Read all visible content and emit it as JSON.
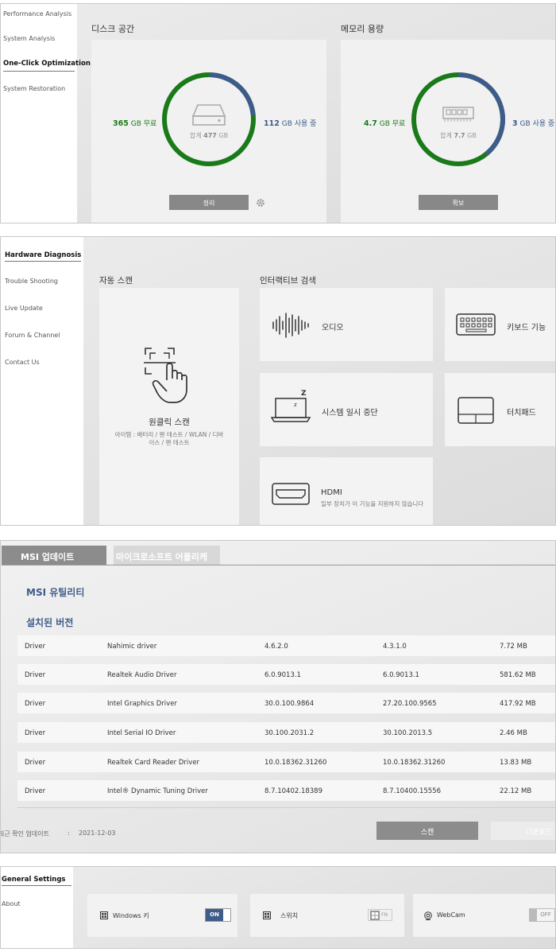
{
  "panel1": {
    "sidebar": [
      "Performance Analysis",
      "System Analysis",
      "One-Click Optimization",
      "System Restoration"
    ],
    "disk": {
      "title": "디스크 공간",
      "free_value": "365",
      "free_unit": "GB 무료",
      "used_value": "112",
      "used_unit": "GB 사용 중",
      "total_prefix": "합계",
      "total_value": "477",
      "total_unit": "GB",
      "button": "정리",
      "used_fraction": 0.235
    },
    "memory": {
      "title": "메모리 용량",
      "free_value": "4.7",
      "free_unit": "GB 무료",
      "used_value": "3",
      "used_unit": "GB 사용 중",
      "total_prefix": "합계",
      "total_value": "7.7",
      "total_unit": "GB",
      "button": "확보",
      "used_fraction": 0.39
    }
  },
  "panel2": {
    "sidebar": [
      "Hardware Diagnosis",
      "Trouble Shooting",
      "Live Update",
      "Forum & Channel",
      "Contact Us"
    ],
    "auto_scan_title": "자동 스캔",
    "interactive_title": "인터랙티브 검색",
    "one_click": {
      "label": "원클릭 스캔",
      "items": "아이템 : 배터리 / 팬 테스트 / WLAN / 디바이스 / 팬 테스트"
    },
    "tiles": {
      "audio": "오디오",
      "keyboard": "키보드 기능",
      "suspend": "시스템 일시 중단",
      "touchpad": "터치패드",
      "hdmi": "HDMI",
      "hdmi_note": "일부 장치가 이 기능을 지원하지 않습니다"
    }
  },
  "panel3": {
    "tabs": [
      "MSI 업데이트",
      "마이크로소프트 어플리케"
    ],
    "utility_title": "MSI 유틸리티",
    "installed_title": "설치된 버전",
    "rows": [
      [
        "Driver",
        "Nahimic driver",
        "4.6.2.0",
        "4.3.1.0",
        "7.72 MB"
      ],
      [
        "Driver",
        "Realtek Audio Driver",
        "6.0.9013.1",
        "6.0.9013.1",
        "581.62 MB"
      ],
      [
        "Driver",
        "Intel Graphics Driver",
        "30.0.100.9864",
        "27.20.100.9565",
        "417.92 MB"
      ],
      [
        "Driver",
        "Intel Serial IO Driver",
        "30.100.2031.2",
        "30.100.2013.5",
        "2.46 MB"
      ],
      [
        "Driver",
        "Realtek Card Reader Driver",
        "10.0.18362.31260",
        "10.0.18362.31260",
        "13.83 MB"
      ],
      [
        "Driver",
        "Intel® Dynamic Tuning Driver",
        "8.7.10402.18389",
        "8.7.10400.15556",
        "22.12 MB"
      ]
    ],
    "last_check_label": "최근 확인 업데이트",
    "last_check_sep": ":",
    "last_check_date": "2021-12-03",
    "scan_button": "스캔",
    "download_button": "다운로드"
  },
  "panel4": {
    "sidebar": [
      "General Settings",
      "About"
    ],
    "windows_key": {
      "label": "Windows 키",
      "toggle": "ON"
    },
    "switch": {
      "label": "스위치",
      "toggle": "FN"
    },
    "webcam": {
      "label": "WebCam",
      "toggle": "OFF"
    }
  }
}
